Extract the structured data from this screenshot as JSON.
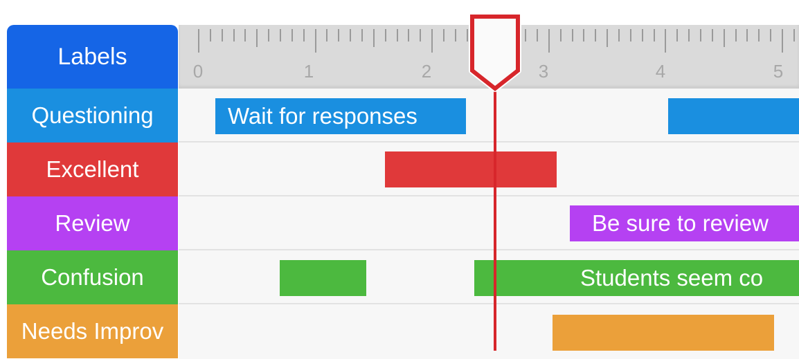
{
  "header": {
    "labels_title": "Labels"
  },
  "colors": {
    "header": "#1565e6",
    "playhead": "#d7262b",
    "ruler_bg": "#dadada",
    "grid_bg": "#f7f7f7"
  },
  "ruler": {
    "numbers": [
      "0",
      "1",
      "2",
      "3",
      "4",
      "5"
    ]
  },
  "rows": [
    {
      "label": "Questioning",
      "color": "#1a8fe0"
    },
    {
      "label": "Excellent",
      "color": "#e0393a"
    },
    {
      "label": "Review",
      "color": "#b541f2"
    },
    {
      "label": "Confusion",
      "color": "#4cb93f"
    },
    {
      "label": "Needs Improv",
      "color": "#eba03a"
    }
  ],
  "bars": [
    {
      "row": 0,
      "color": "#1a8fe0",
      "text": "Wait for responses"
    },
    {
      "row": 0,
      "color": "#1a8fe0",
      "text": ""
    },
    {
      "row": 1,
      "color": "#e0393a",
      "text": ""
    },
    {
      "row": 2,
      "color": "#b541f2",
      "text": "Be sure to review"
    },
    {
      "row": 3,
      "color": "#4cb93f",
      "text": ""
    },
    {
      "row": 3,
      "color": "#4cb93f",
      "text": "Students seem co"
    },
    {
      "row": 4,
      "color": "#eba03a",
      "text": ""
    }
  ]
}
